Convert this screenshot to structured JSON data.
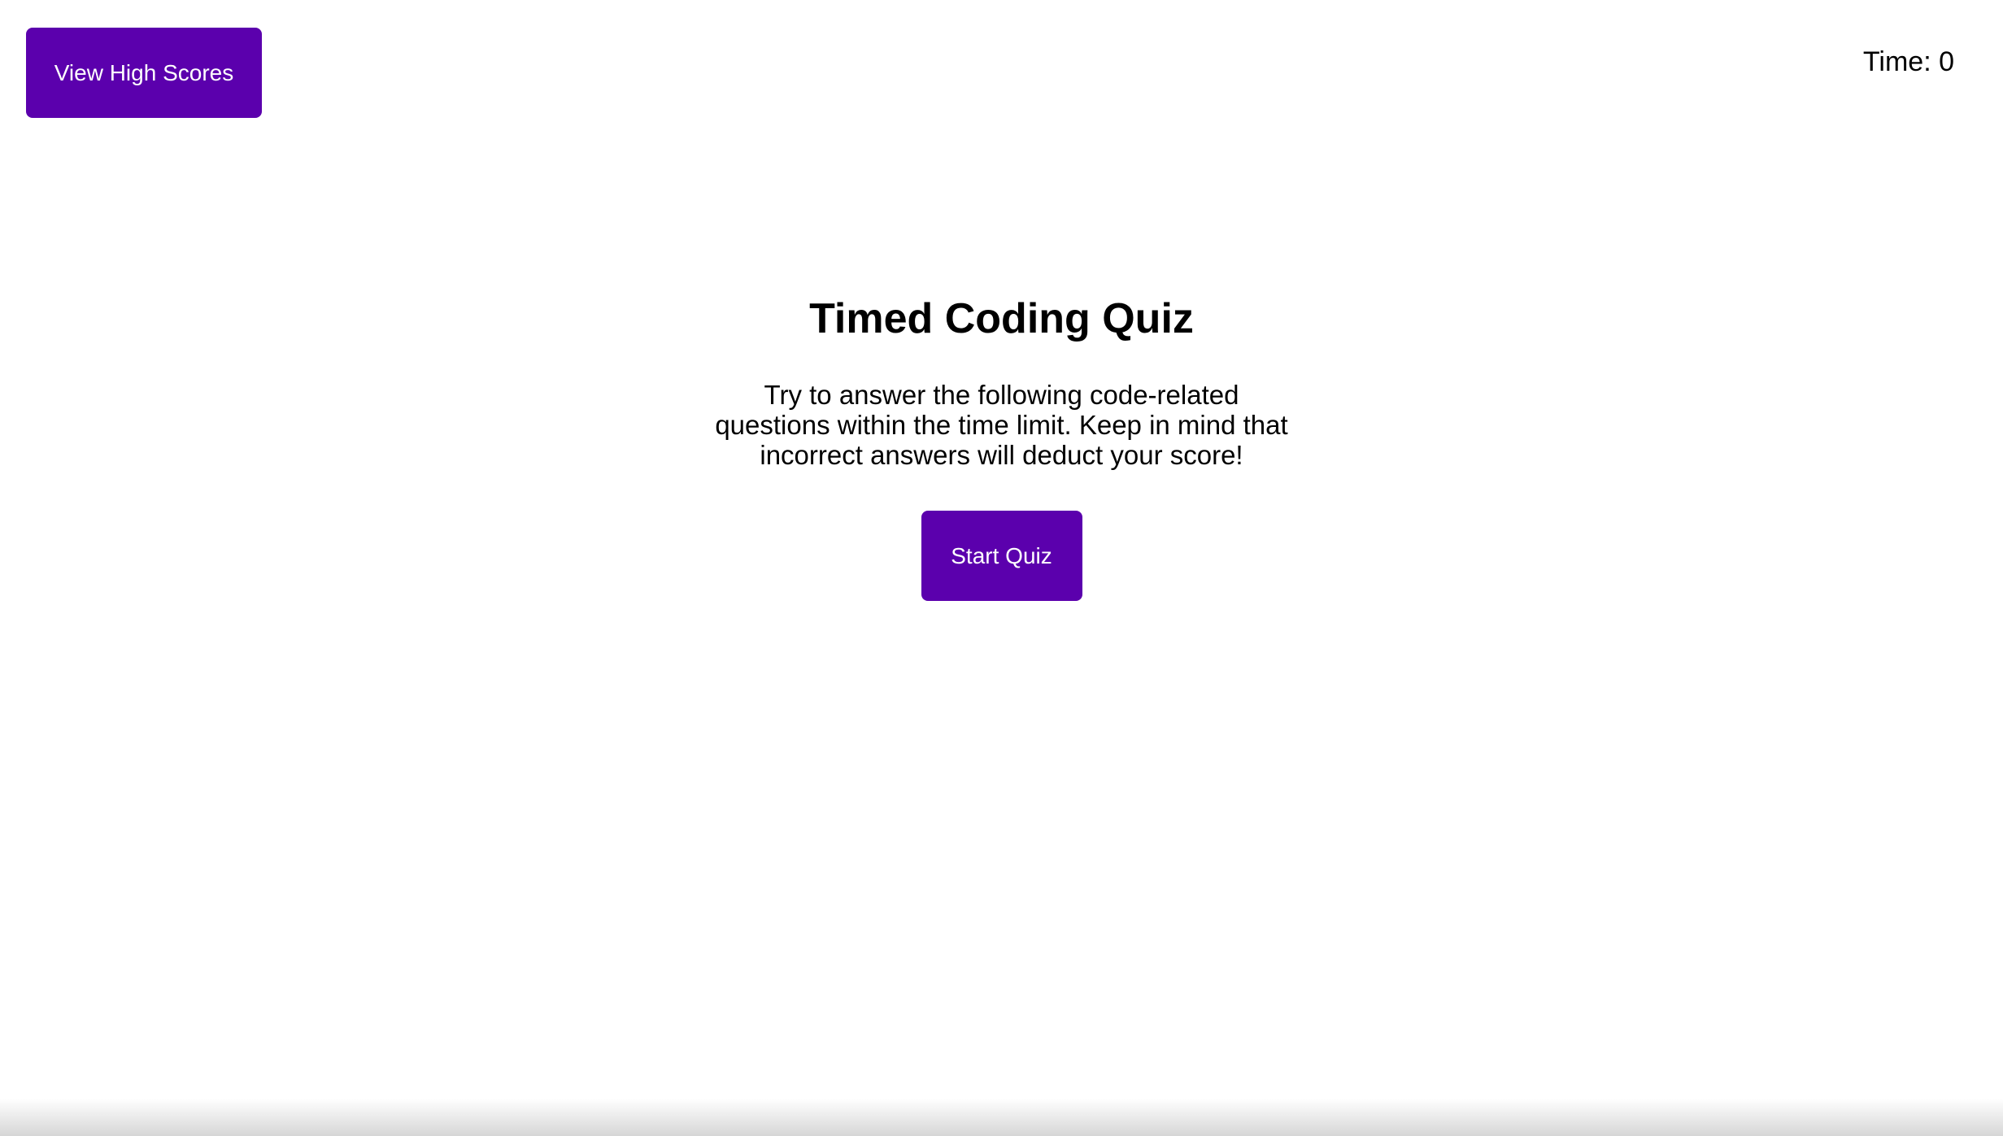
{
  "header": {
    "high_scores_label": "View High Scores",
    "timer_text": "Time: 0"
  },
  "main": {
    "title": "Timed Coding Quiz",
    "description": "Try to answer the following code-related questions within the time limit. Keep in mind that incorrect answers will deduct your score!",
    "start_label": "Start Quiz"
  },
  "colors": {
    "button_background": "#5b00ad",
    "button_text": "#ffffff",
    "page_background": "#ffffff",
    "text": "#000000"
  }
}
